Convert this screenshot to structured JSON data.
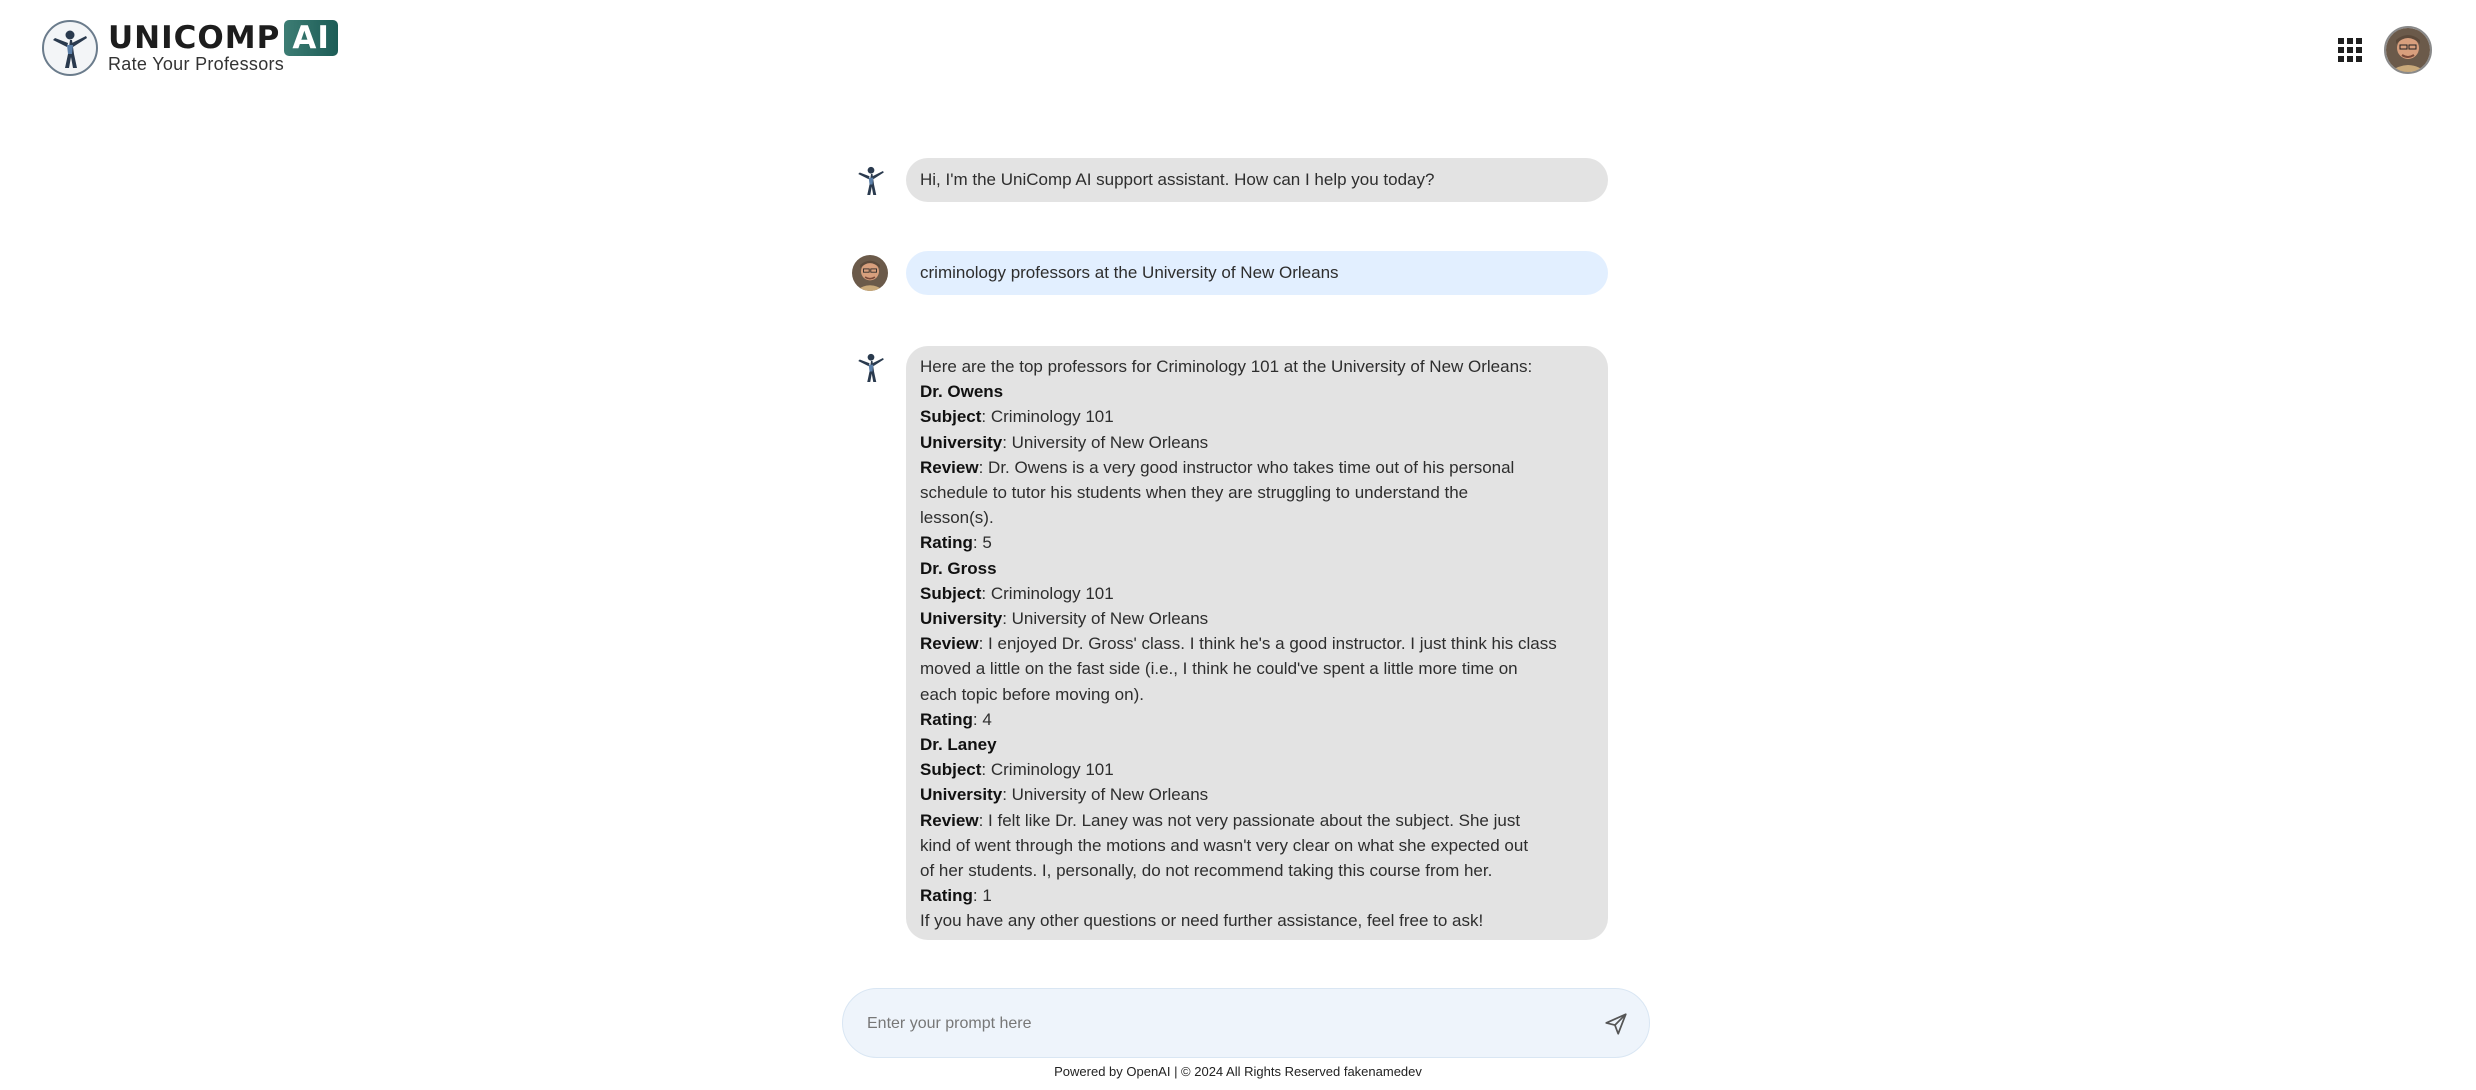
{
  "brand": {
    "name": "UNICOMP",
    "ai_badge": "AI",
    "tagline": "Rate Your Professors"
  },
  "header": {
    "apps_icon": "grid-apps-icon",
    "avatar_icon": "user-avatar"
  },
  "chat": {
    "greeting": "Hi, I'm the UniComp AI support assistant. How can I help you today?",
    "user_query": "criminology professors at the University of New Orleans",
    "response": {
      "intro": "Here are the top professors for Criminology 101 at the University of New Orleans:",
      "field_labels": {
        "subject": "Subject",
        "university": "University",
        "review": "Review",
        "rating": "Rating"
      },
      "professors": [
        {
          "name": "Dr. Owens",
          "subject": ": Criminology 101",
          "university": ": University of New Orleans",
          "review_lines": [
            ": Dr. Owens is a very good instructor who takes time out of his personal",
            "schedule to tutor his students when they are struggling to understand the",
            "lesson(s)."
          ],
          "rating": ": 5"
        },
        {
          "name": "Dr. Gross",
          "subject": ": Criminology 101",
          "university": ": University of New Orleans",
          "review_lines": [
            ": I enjoyed Dr. Gross' class. I think he's a good instructor. I just think his class",
            "moved a little on the fast side (i.e., I think he could've spent a little more time on",
            "each topic before moving on)."
          ],
          "rating": ": 4"
        },
        {
          "name": "Dr. Laney",
          "subject": ": Criminology 101",
          "university": ": University of New Orleans",
          "review_lines": [
            ": I felt like Dr. Laney was not very passionate about the subject. She just",
            "kind of went through the motions and wasn't very clear on what she expected out",
            "of her students. I, personally, do not recommend taking this course from her."
          ],
          "rating": ": 1"
        }
      ],
      "outro": "If you have any other questions or need further assistance, feel free to ask!"
    }
  },
  "prompt": {
    "placeholder": "Enter your prompt here",
    "value": "",
    "send_icon": "send-icon"
  },
  "footer": {
    "text": "Powered by OpenAI | © 2024 All Rights Reserved fakenamedev"
  },
  "colors": {
    "assistant_bubble": "#e3e3e3",
    "user_bubble": "#e2efff",
    "prompt_bg": "#eef4fb",
    "brand_ai_badge": "#2a6a63"
  }
}
